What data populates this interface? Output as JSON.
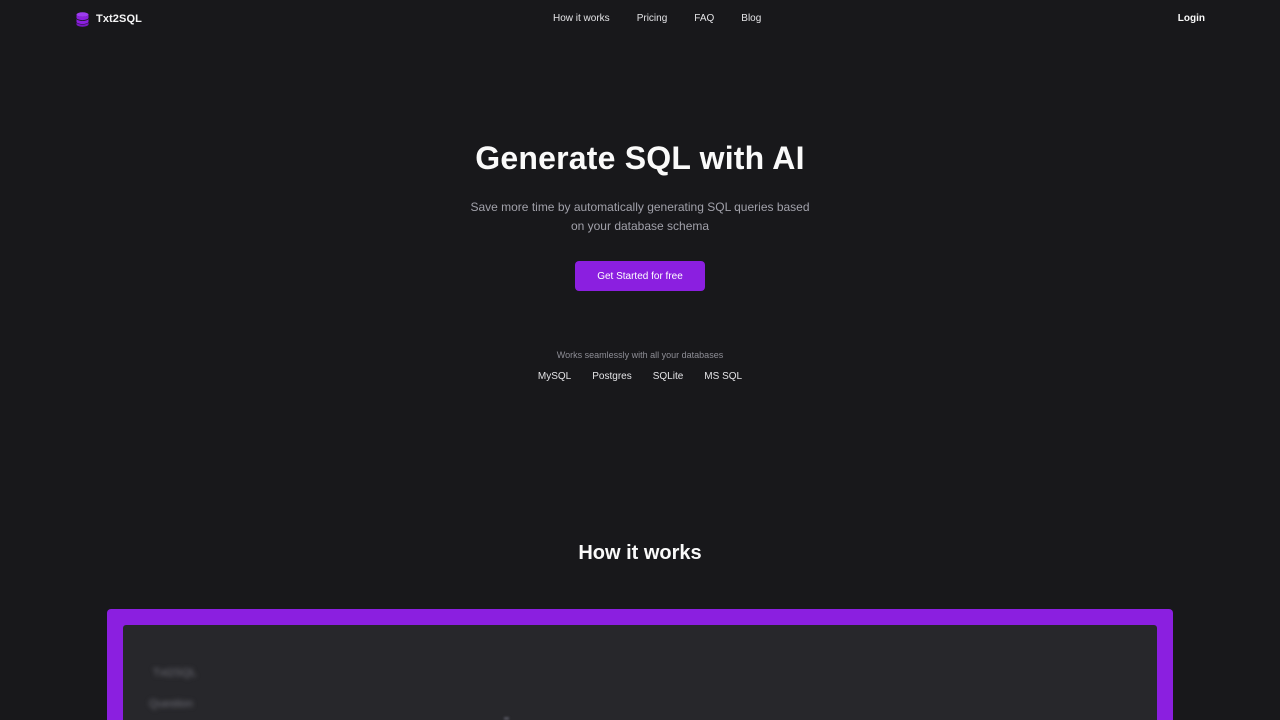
{
  "brand": {
    "name": "Txt2SQL",
    "icon": "database-icon",
    "accent_color": "#8b1fe0"
  },
  "nav": {
    "items": [
      {
        "label": "How it works"
      },
      {
        "label": "Pricing"
      },
      {
        "label": "FAQ"
      },
      {
        "label": "Blog"
      }
    ],
    "login_label": "Login"
  },
  "hero": {
    "title": "Generate SQL with AI",
    "subtitle": "Save more time by automatically generating SQL queries based on your database schema",
    "cta_label": "Get Started for free"
  },
  "databases": {
    "caption": "Works seamlessly with all your databases",
    "items": [
      "MySQL",
      "Postgres",
      "SQLite",
      "MS SQL"
    ]
  },
  "how_it_works": {
    "title": "How it works",
    "demo_lines": [
      "Txt2SQL",
      "Question"
    ]
  },
  "colors": {
    "background": "#18181b",
    "accent": "#8b1fe0",
    "panel": "#27272b"
  }
}
